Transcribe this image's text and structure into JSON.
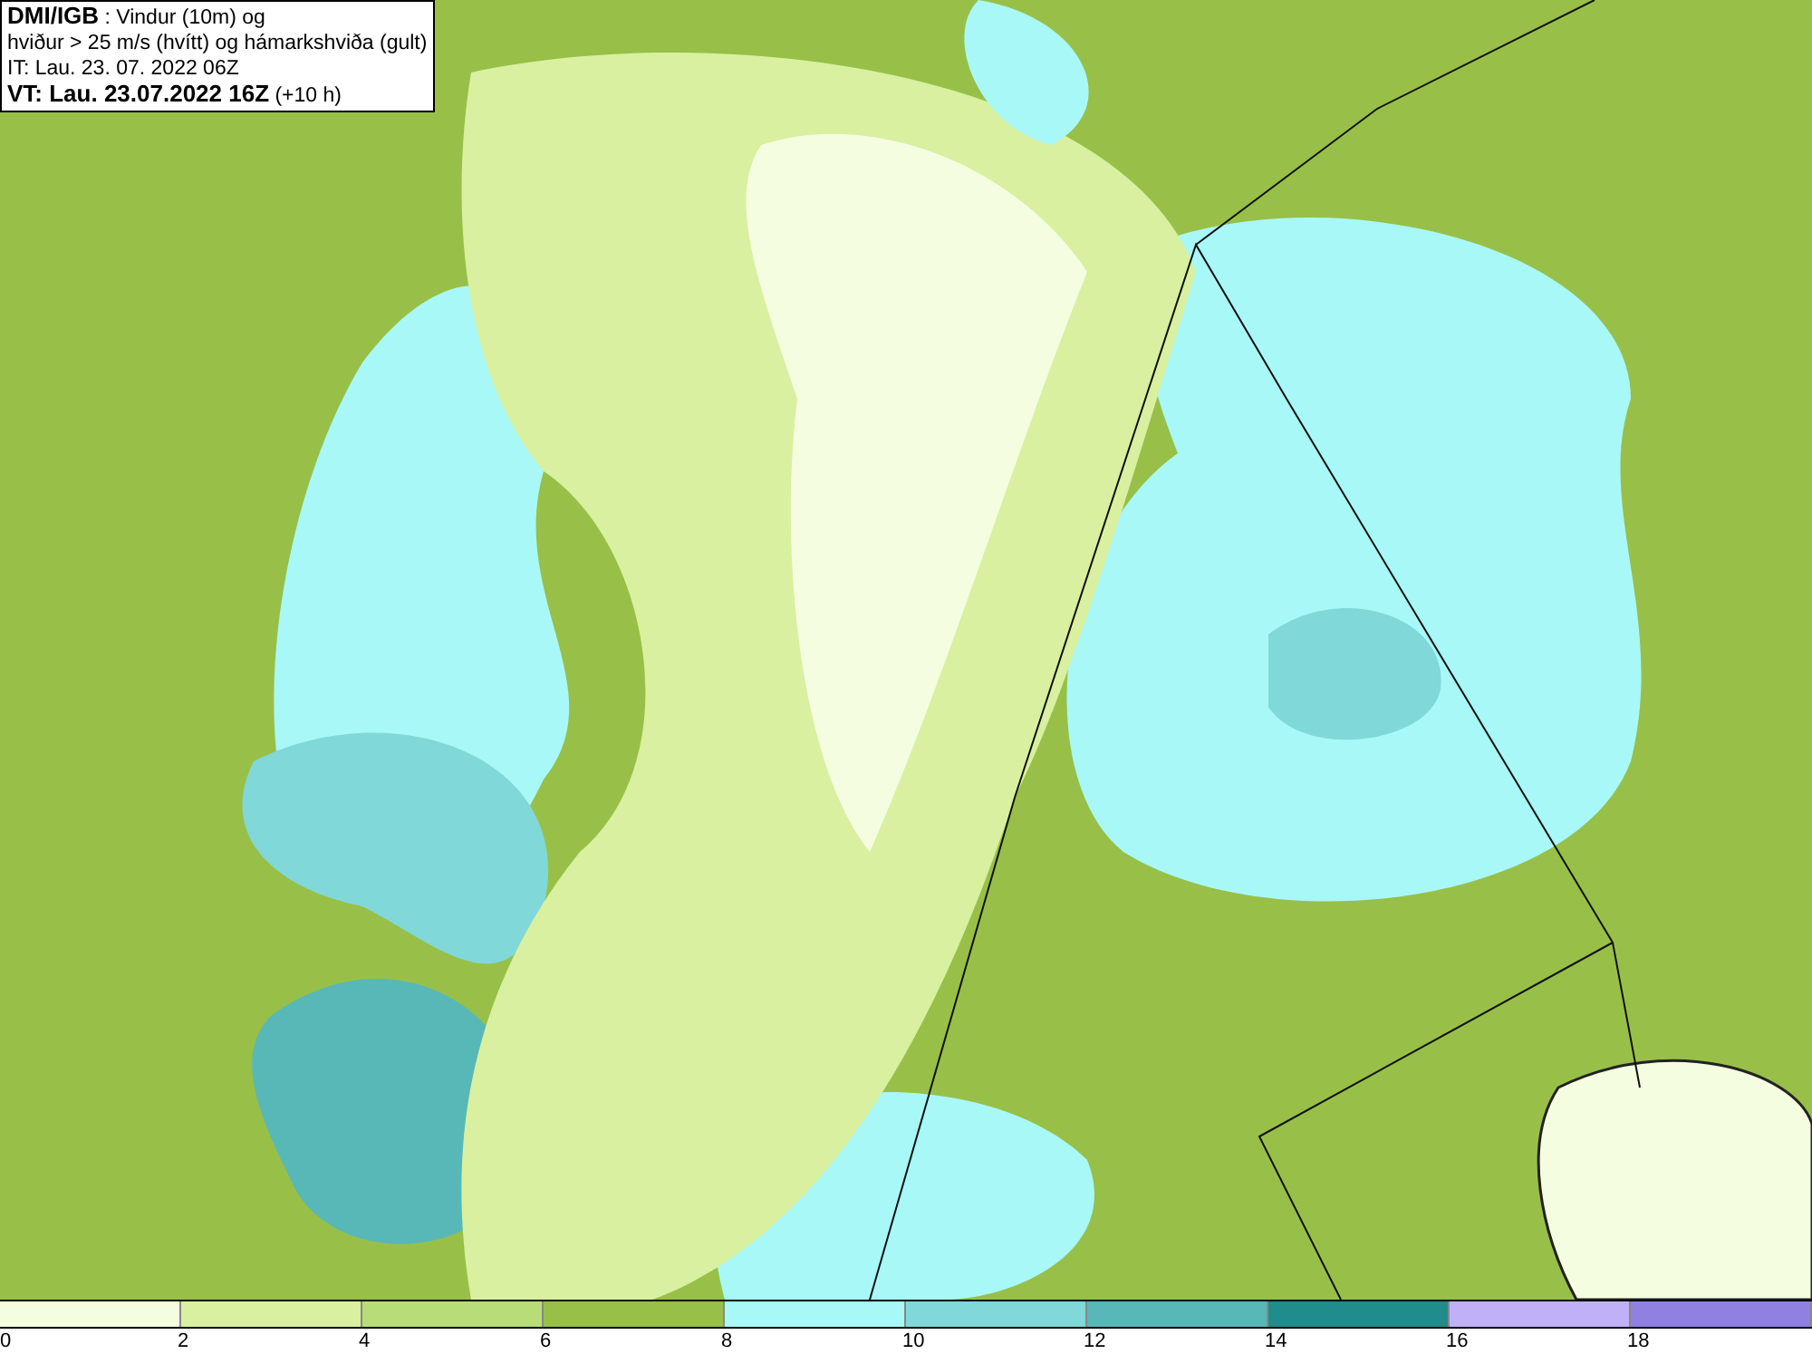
{
  "info_box": {
    "lines": [
      "**DMI/IGB** : Vindur (10m) og",
      "hviður > 25 m/s (hvítt) og hámarkshviða (gult)",
      "IT: Lau. 23. 07. 2022 06Z",
      "**VT: Lau. 23.07.2022 16Z** (+10 h)"
    ]
  },
  "color_scale": {
    "segments": [
      {
        "color": "#f5fde0",
        "label": "0"
      },
      {
        "color": "#d8f0a0",
        "label": "2"
      },
      {
        "color": "#b8dc78",
        "label": "4"
      },
      {
        "color": "#98c048",
        "label": "6"
      },
      {
        "color": "#a8f8f8",
        "label": "8"
      },
      {
        "color": "#80d8d8",
        "label": "10"
      },
      {
        "color": "#58b8b8",
        "label": "12"
      },
      {
        "color": "#208c8c",
        "label": "14"
      },
      {
        "color": "#c0b0f8",
        "label": "16"
      },
      {
        "color": "#9080e0",
        "label": "18"
      }
    ]
  }
}
